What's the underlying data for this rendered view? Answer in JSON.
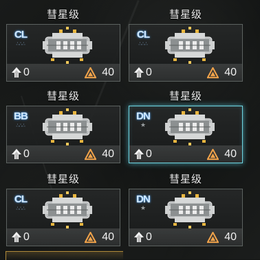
{
  "cards": [
    {
      "title": "彗星级",
      "class_code": "CL",
      "class_mark": "dots",
      "stat_left": "0",
      "stat_right": "40",
      "selected": false
    },
    {
      "title": "彗星级",
      "class_code": "CL",
      "class_mark": "dots",
      "stat_left": "0",
      "stat_right": "40",
      "selected": false
    },
    {
      "title": "彗星级",
      "class_code": "BB",
      "class_mark": "dots",
      "stat_left": "0",
      "stat_right": "40",
      "selected": false
    },
    {
      "title": "彗星级",
      "class_code": "DN",
      "class_mark": "star",
      "stat_left": "0",
      "stat_right": "40",
      "selected": true
    },
    {
      "title": "彗星级",
      "class_code": "CL",
      "class_mark": "dots",
      "stat_left": "0",
      "stat_right": "40",
      "selected": false
    },
    {
      "title": "彗星级",
      "class_code": "DN",
      "class_mark": "star",
      "stat_left": "0",
      "stat_right": "40",
      "selected": false
    }
  ],
  "colors": {
    "selected_border": "#6fd6e2",
    "class_badge_glow": "#4aa5ff",
    "cost_icon": "#f0a24a",
    "text": "#f0f0f0"
  },
  "icons": {
    "class_mark_dots": "triangle-dots-icon",
    "class_mark_star": "star-icon",
    "stat_left": "fleet-up-arrow-icon",
    "stat_right": "command-cost-icon",
    "ship": "spaceship-icon"
  }
}
